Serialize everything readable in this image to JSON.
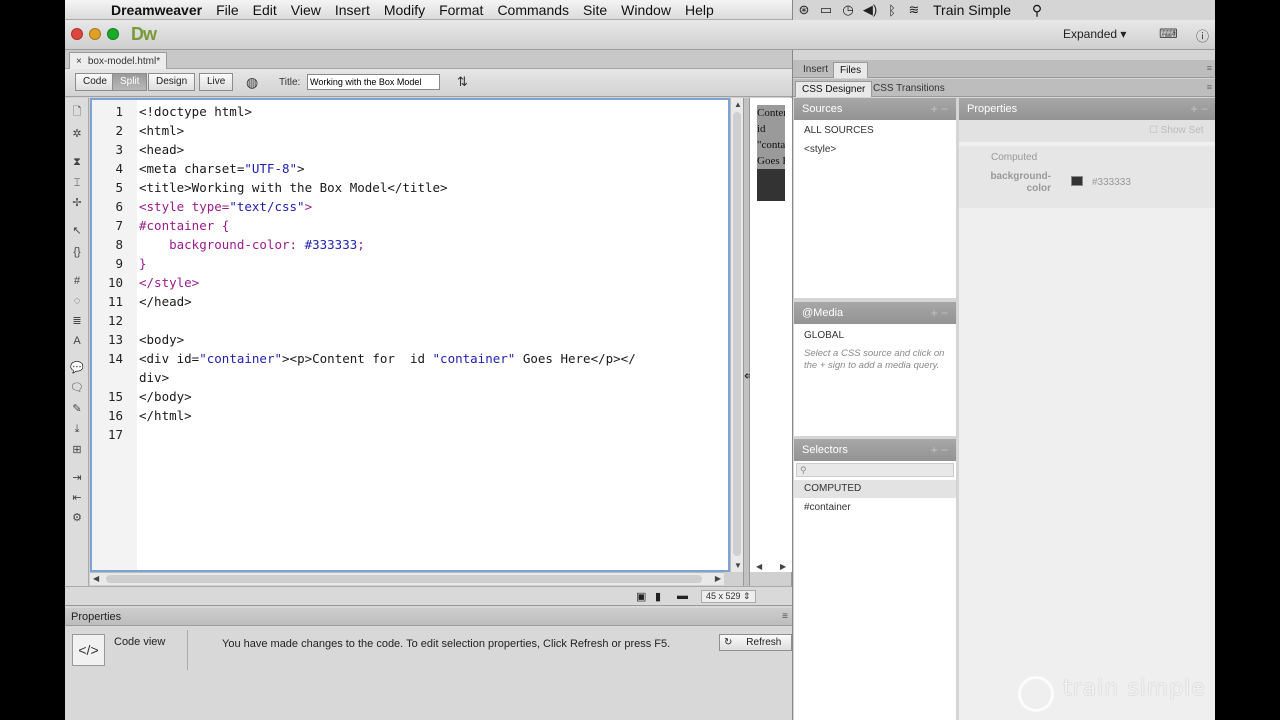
{
  "menubar": {
    "app_name": "Dreamweaver",
    "items": [
      "File",
      "Edit",
      "View",
      "Insert",
      "Modify",
      "Format",
      "Commands",
      "Site",
      "Window",
      "Help"
    ],
    "user": "Train Simple"
  },
  "appbar": {
    "logo": "Dw",
    "workspace": "Expanded"
  },
  "document": {
    "tab_label": "box-model.html*",
    "views": [
      "Code",
      "Split",
      "Design",
      "Live"
    ],
    "active_view": "Split",
    "title_label": "Title:",
    "title_value": "Working with the Box Model",
    "code_lines": [
      {
        "n": "1",
        "parts": [
          {
            "t": "<!doctype html>",
            "c": ""
          }
        ]
      },
      {
        "n": "2",
        "parts": [
          {
            "t": "<html>",
            "c": ""
          }
        ]
      },
      {
        "n": "3",
        "parts": [
          {
            "t": "<head>",
            "c": ""
          }
        ]
      },
      {
        "n": "4",
        "parts": [
          {
            "t": "<meta charset=",
            "c": ""
          },
          {
            "t": "\"UTF-8\"",
            "c": "k-str"
          },
          {
            "t": ">",
            "c": ""
          }
        ]
      },
      {
        "n": "5",
        "parts": [
          {
            "t": "<title>Working with the Box Model</title>",
            "c": ""
          }
        ]
      },
      {
        "n": "6",
        "parts": [
          {
            "t": "<style type=",
            "c": "k-css"
          },
          {
            "t": "\"text/css\"",
            "c": "k-str"
          },
          {
            "t": ">",
            "c": "k-css"
          }
        ]
      },
      {
        "n": "7",
        "parts": [
          {
            "t": "#container {",
            "c": "k-css"
          }
        ]
      },
      {
        "n": "8",
        "parts": [
          {
            "t": "    background-color: ",
            "c": "k-css"
          },
          {
            "t": "#333333",
            "c": "k-str"
          },
          {
            "t": ";",
            "c": "k-css"
          }
        ]
      },
      {
        "n": "9",
        "parts": [
          {
            "t": "}",
            "c": "k-css"
          }
        ]
      },
      {
        "n": "10",
        "parts": [
          {
            "t": "</style>",
            "c": "k-css"
          }
        ]
      },
      {
        "n": "11",
        "parts": [
          {
            "t": "</head>",
            "c": ""
          }
        ]
      },
      {
        "n": "12",
        "parts": [
          {
            "t": "",
            "c": ""
          }
        ]
      },
      {
        "n": "13",
        "parts": [
          {
            "t": "<body>",
            "c": ""
          }
        ]
      },
      {
        "n": "14",
        "parts": [
          {
            "t": "<div id=",
            "c": ""
          },
          {
            "t": "\"container\"",
            "c": "k-str"
          },
          {
            "t": "><p>Content for  id ",
            "c": ""
          },
          {
            "t": "\"container\"",
            "c": "k-str"
          },
          {
            "t": " Goes Here</p></",
            "c": ""
          }
        ]
      },
      {
        "n": "",
        "parts": [
          {
            "t": "div>",
            "c": ""
          }
        ]
      },
      {
        "n": "15",
        "parts": [
          {
            "t": "</body>",
            "c": ""
          }
        ]
      },
      {
        "n": "16",
        "parts": [
          {
            "t": "</html>",
            "c": ""
          }
        ]
      },
      {
        "n": "17",
        "parts": [
          {
            "t": "",
            "c": ""
          }
        ]
      }
    ],
    "design_preview_text": "Content for id \"container\" Goes Here",
    "window_size": "45 x 529"
  },
  "properties": {
    "title": "Properties",
    "mode_label": "Code view",
    "message": "You have made changes to the code. To edit selection properties, Click Refresh or press F5.",
    "refresh_label": "Refresh"
  },
  "right_panels": {
    "top_tabs": [
      "Insert",
      "Files"
    ],
    "css_tabs": [
      "CSS Designer",
      "CSS Transitions"
    ],
    "sources": {
      "title": "Sources",
      "items": [
        "ALL SOURCES",
        "<style>"
      ]
    },
    "media": {
      "title": "@Media",
      "global": "GLOBAL",
      "hint": "Select a CSS source and click on the + sign to add a media query."
    },
    "selectors": {
      "title": "Selectors",
      "computed": "COMPUTED",
      "items": [
        "#container"
      ]
    },
    "properties_panel": {
      "title": "Properties",
      "show_set": "Show Set",
      "computed_label": "Computed",
      "prop_name": "background-color",
      "prop_value": "#333333",
      "swatch_color": "#333333"
    }
  },
  "watermark": "train simple"
}
